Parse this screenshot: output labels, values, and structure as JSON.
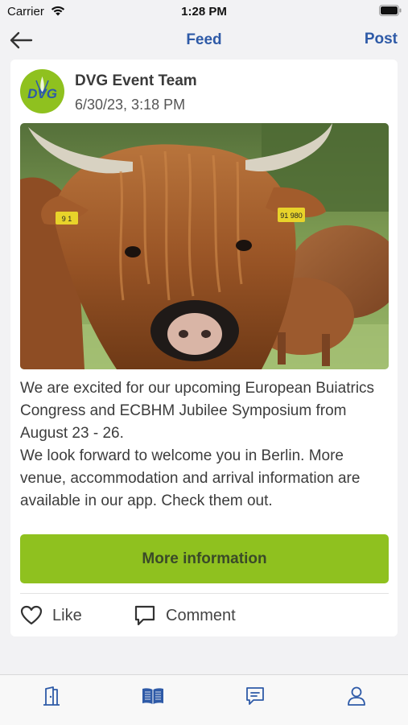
{
  "status_bar": {
    "carrier": "Carrier",
    "time": "1:28 PM",
    "icons": [
      "wifi-icon",
      "battery-icon"
    ]
  },
  "nav": {
    "back_icon": "arrow-left-icon",
    "title": "Feed",
    "post_label": "Post"
  },
  "post": {
    "author": "DVG Event Team",
    "avatar_text": "DVG",
    "date": "6/30/23, 3:18 PM",
    "image_description_icon": "photo",
    "ear_tag_left": "9 1",
    "ear_tag_right": "91 980",
    "paragraphs": [
      "We are excited for our upcoming European Buiatrics Congress and ECBHM Jubilee Symposium from August 23 - 26.",
      "We look forward to welcome you in Berlin. More venue, accommodation and arrival information are available in our app. Check them out."
    ],
    "button_label": "More information",
    "like_label": "Like",
    "comment_label": "Comment"
  },
  "tabs": [
    {
      "icon": "door-icon",
      "active": false
    },
    {
      "icon": "book-icon",
      "active": true
    },
    {
      "icon": "chat-icon",
      "active": false
    },
    {
      "icon": "person-icon",
      "active": false
    }
  ],
  "colors": {
    "accent_blue": "#2e5aa7",
    "brand_green": "#8fc11f",
    "background": "#f2f2f4",
    "card": "#ffffff"
  }
}
